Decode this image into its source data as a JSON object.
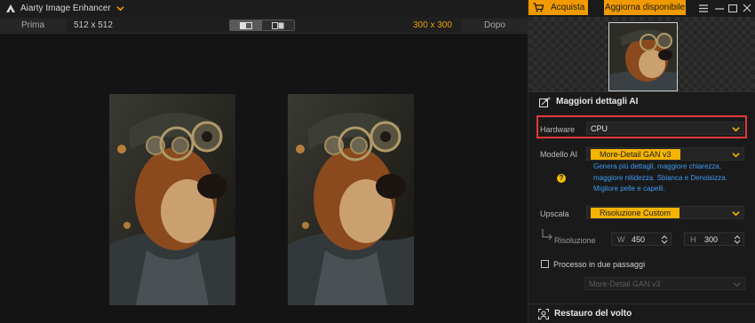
{
  "app": {
    "title": "Aiarty Image Enhancer"
  },
  "compare": {
    "before_label": "Prima",
    "before_size": "512 x 512",
    "after_size": "300 x 300",
    "after_label": "Dopo"
  },
  "panel": {
    "buy_label": "Acquista",
    "update_label": "Aggiorna disponibile",
    "section_title": "Maggiori dettagli AI",
    "hardware": {
      "label": "Hardware",
      "value": "CPU"
    },
    "model": {
      "label": "Modello AI",
      "value": "More-Detail GAN  v3",
      "description": "Genera più dettagli, maggiore chiarezza, maggiore nitidezza. Sbianca e Denoisizza. Migliore pelle e capelli."
    },
    "upscale": {
      "label": "Upscala",
      "value": "Risoluzione Custom"
    },
    "resolution": {
      "label": "Risoluzione",
      "w_prefix": "W",
      "w_value": "450",
      "h_prefix": "H",
      "h_value": "300"
    },
    "two_pass": {
      "label": "Processo in due passaggi",
      "checked": false,
      "model_value": "More-Detail GAN  v3"
    },
    "face_section_title": "Restauro del volto"
  },
  "colors": {
    "accent": "#f19a00",
    "highlight": "#e03a3a",
    "link": "#3c9bf0"
  }
}
